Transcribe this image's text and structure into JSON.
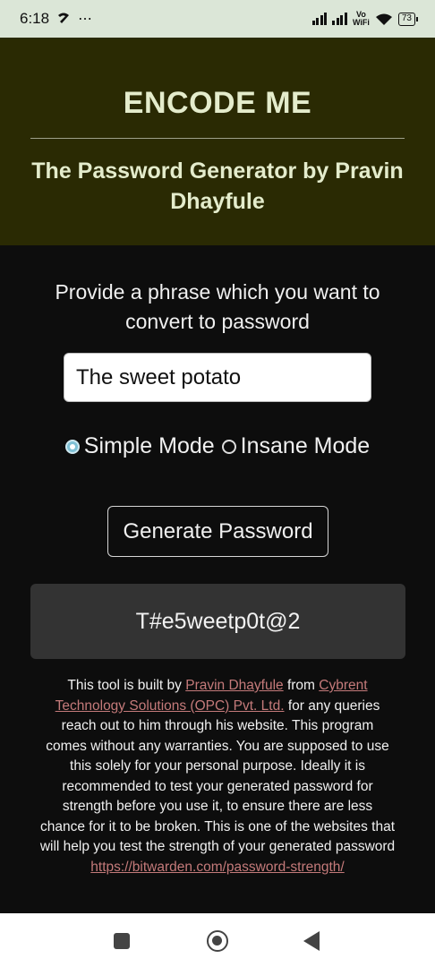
{
  "status_bar": {
    "time": "6:18",
    "vowifi_top": "Vo",
    "vowifi_bottom": "WiFi",
    "battery": "73"
  },
  "header": {
    "title": "ENCODE ME",
    "subtitle": "The Password Generator by Pravin Dhayfule"
  },
  "main": {
    "prompt": "Provide a phrase which you want to convert to password",
    "phrase_value": "The sweet potato",
    "modes": [
      {
        "label": "Simple Mode",
        "selected": true
      },
      {
        "label": "Insane Mode",
        "selected": false
      }
    ],
    "generate_label": "Generate Password",
    "output": "T#e5weetp0t@2"
  },
  "footer": {
    "part1": "This tool is built by ",
    "author_link": "Pravin Dhayfule",
    "part2": " from ",
    "company_link": "Cybrent Technology Solutions (OPC) Pvt. Ltd.",
    "part3": " for any queries reach out to him through his website. This program comes without any warranties. You are supposed to use this solely for your personal purpose. Ideally it is recommended to test your generated password for strength before you use it, to ensure there are less chance for it to be broken. This is one of the websites that will help you test the strength of your generated password ",
    "strength_link": "https://bitwarden.com/password-strength/"
  },
  "colors": {
    "header_bg": "#2a2a03",
    "header_text": "#e4eccc",
    "link": "#c47a7a",
    "radio_selected": "#7fc1d6"
  }
}
